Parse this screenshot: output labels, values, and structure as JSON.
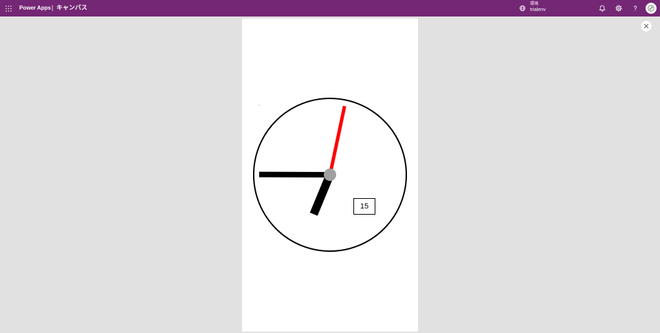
{
  "topbar": {
    "app_launcher_icon": "waffle-icon",
    "app_name": "Power Apps",
    "separator": "|",
    "section_title": "キャンバス",
    "environment": {
      "icon": "environment-icon",
      "label": "環境",
      "name": "trialenv"
    },
    "actions": {
      "notifications_icon": "bell-icon",
      "settings_icon": "gear-icon",
      "help_icon": "question-icon",
      "account_icon": "avatar-icon"
    }
  },
  "preview": {
    "close_icon": "close-icon",
    "clock": {
      "hours": 6,
      "minutes": 45,
      "seconds": 2
    },
    "date_label": "15"
  },
  "colors": {
    "topbar": "#742774",
    "workspace": "#e1e1e1",
    "canvas": "#ffffff",
    "clock_face_stroke": "#000000",
    "second_hand": "#ff0000",
    "minute_hand": "#000000",
    "hour_hand": "#000000",
    "hub": "#a0a0a0"
  }
}
